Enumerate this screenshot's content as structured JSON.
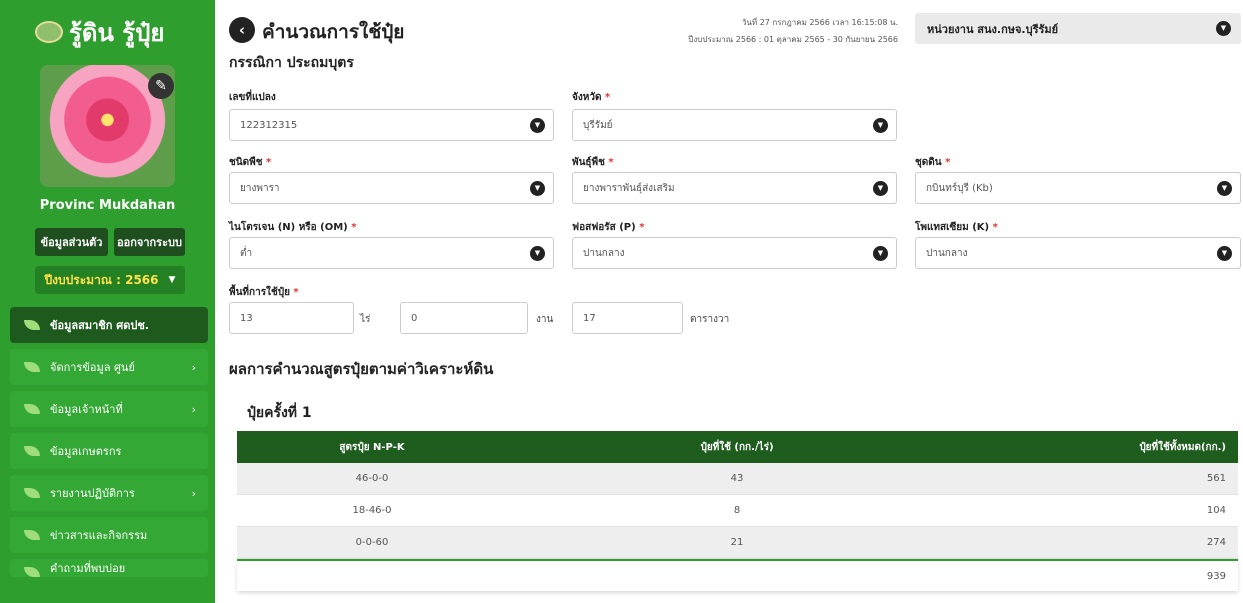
{
  "brand": {
    "title": "รู้ดิน รู้ปุ๋ย"
  },
  "user": {
    "name": "Provinc Mukdahan"
  },
  "sidebar_buttons": {
    "profile": "ข้อมูลส่วนตัว",
    "logout": "ออกจากระบบ"
  },
  "fiscal_year_select": "ปีงบประมาณ : 2566",
  "menu": [
    {
      "label": "ข้อมูลสมาชิก ศดปช.",
      "has_submenu": false
    },
    {
      "label": "จัดการข้อมูล ศูนย์",
      "has_submenu": true
    },
    {
      "label": "ข้อมูลเจ้าหน้าที่",
      "has_submenu": true
    },
    {
      "label": "ข้อมูลเกษตรกร",
      "has_submenu": false
    },
    {
      "label": "รายงานปฏิบัติการ",
      "has_submenu": true
    },
    {
      "label": "ข่าวสารและกิจกรรม",
      "has_submenu": false
    },
    {
      "label": "คำถามที่พบบ่อย",
      "has_submenu": false
    }
  ],
  "header": {
    "title": "คำนวณการใช้ปุ๋ย",
    "date_line": "วันที่ 27 กรกฎาคม 2566 เวลา 16:15:08 น.",
    "fiscal_line": "ปีงบประมาณ 2566 : 01 ตุลาคม 2565 - 30 กันยายน 2566",
    "agency": "หน่วยงาน สนง.กษจ.บุรีรัมย์"
  },
  "farmer_name": "กรรณิกา ประถมบุตร",
  "form": {
    "plot_no": {
      "label": "เลขที่แปลง",
      "value": "122312315"
    },
    "province": {
      "label": "จังหวัด",
      "value": "บุรีรัมย์"
    },
    "crop_type": {
      "label": "ชนิดพืช",
      "value": "ยางพารา"
    },
    "crop_variety": {
      "label": "พันธุ์พืช",
      "value": "ยางพาราพันธุ์ส่งเสริม"
    },
    "soil_series": {
      "label": "ชุดดิน",
      "value": "กบินทร์บุรี (Kb)"
    },
    "nitrogen": {
      "label": "ไนโตรเจน (N) หรือ (OM)",
      "value": "ต่ำ"
    },
    "phosphorus": {
      "label": "ฟอสฟอรัส (P)",
      "value": "ปานกลาง"
    },
    "potassium": {
      "label": "โพแทสเซียม (K)",
      "value": "ปานกลาง"
    },
    "area": {
      "label": "พื้นที่การใช้ปุ๋ย",
      "rai": "13",
      "rai_unit": "ไร่",
      "ngan": "0",
      "ngan_unit": "งาน",
      "wa": "17",
      "wa_unit": "ตารางวา"
    }
  },
  "results": {
    "title": "ผลการคำนวณสูตรปุ๋ยตามค่าวิเคราะห์ดิน",
    "round_title": "ปุ๋ยครั้งที่ 1",
    "columns": [
      "สูตรปุ๋ย N-P-K",
      "ปุ๋ยที่ใช้ (กก./ไร่)",
      "ปุ๋ยที่ใช้ทั้งหมด(กก.)"
    ],
    "rows": [
      {
        "formula": "46-0-0",
        "per_rai": "43",
        "total": "561"
      },
      {
        "formula": "18-46-0",
        "per_rai": "8",
        "total": "104"
      },
      {
        "formula": "0-0-60",
        "per_rai": "21",
        "total": "274"
      }
    ],
    "grand_total": "939"
  },
  "colors": {
    "sidebar": "#2e9e2e",
    "table_header": "#1f5d1f",
    "required": "#e0312f",
    "year_text": "#ffe14a"
  }
}
